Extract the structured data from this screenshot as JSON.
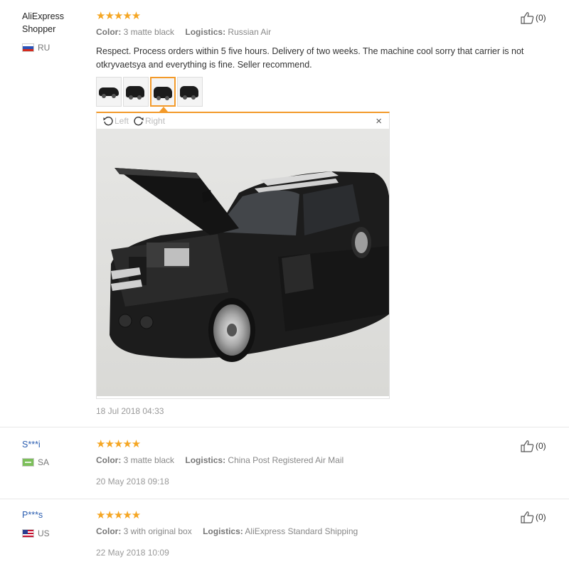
{
  "reviews": [
    {
      "user": "AliExpress Shopper",
      "country": "RU",
      "stars": "★★★★★",
      "color_label": "Color:",
      "color_value": "3 matte black",
      "logistics_label": "Logistics:",
      "logistics_value": "Russian Air",
      "helpful": "(0)",
      "text": "Respect. Process orders within 5 five hours. Delivery of two weeks. The machine cool sorry that carrier is not otkryvaetsya and everything is fine. Seller recommend.",
      "viewer": {
        "left": "Left",
        "right": "Right",
        "close": "×"
      },
      "date": "18 Jul 2018 04:33"
    },
    {
      "user": "S***i",
      "country": "SA",
      "stars": "★★★★★",
      "color_label": "Color:",
      "color_value": "3 matte black",
      "logistics_label": "Logistics:",
      "logistics_value": "China Post Registered Air Mail",
      "helpful": "(0)",
      "date": "20 May 2018 09:18"
    },
    {
      "user": "P***s",
      "country": "US",
      "stars": "★★★★★",
      "color_label": "Color:",
      "color_value": "3 with original box",
      "logistics_label": "Logistics:",
      "logistics_value": "AliExpress Standard Shipping",
      "helpful": "(0)",
      "date": "22 May 2018 10:09"
    }
  ],
  "colors": {
    "star": "#f5a623",
    "accent": "#f39a2a",
    "link": "#2a5db0"
  }
}
